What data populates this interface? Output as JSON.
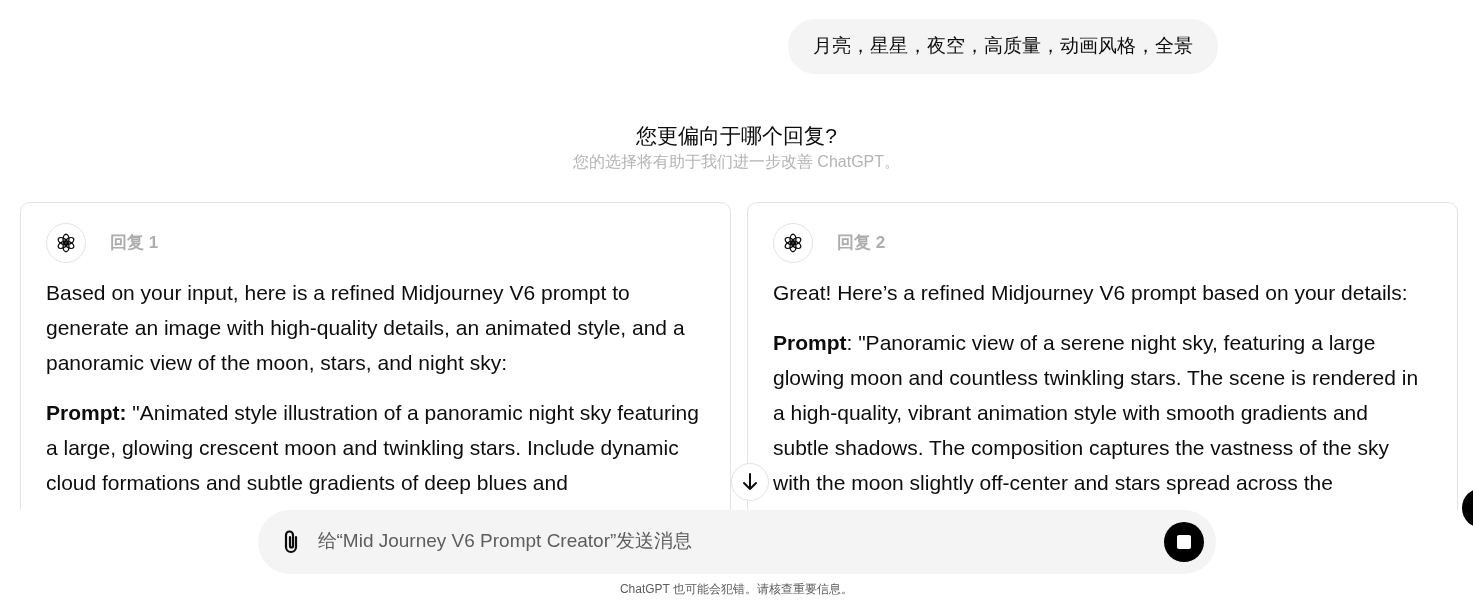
{
  "user_message": "月亮，星星，夜空，高质量，动画风格，全景",
  "comparison": {
    "title": "您更偏向于哪个回复?",
    "subtitle": "您的选择将有助于我们进一步改善 ChatGPT。"
  },
  "responses": [
    {
      "label": "回复 1",
      "paragraphs": [
        "Based on your input, here is a refined Midjourney V6 prompt to generate an image with high-quality details, an animated style, and a panoramic view of the moon, stars, and night sky:",
        "**Prompt:** \"Animated style illustration of a panoramic night sky featuring a large, glowing crescent moon and twinkling stars. Include dynamic cloud formations and subtle gradients of deep blues and"
      ]
    },
    {
      "label": "回复 2",
      "paragraphs": [
        "Great! Here’s a refined Midjourney V6 prompt based on your details:",
        "**Prompt**: \"Panoramic view of a serene night sky, featuring a large glowing moon and countless twinkling stars. The scene is rendered in a high-quality, vibrant animation style with smooth gradients and subtle shadows. The composition captures the vastness of the sky with the moon slightly off-center and stars spread across the"
      ]
    }
  ],
  "composer": {
    "placeholder": "给“Mid Journey V6 Prompt Creator”发送消息"
  },
  "disclaimer": "ChatGPT 也可能会犯错。请核查重要信息。"
}
